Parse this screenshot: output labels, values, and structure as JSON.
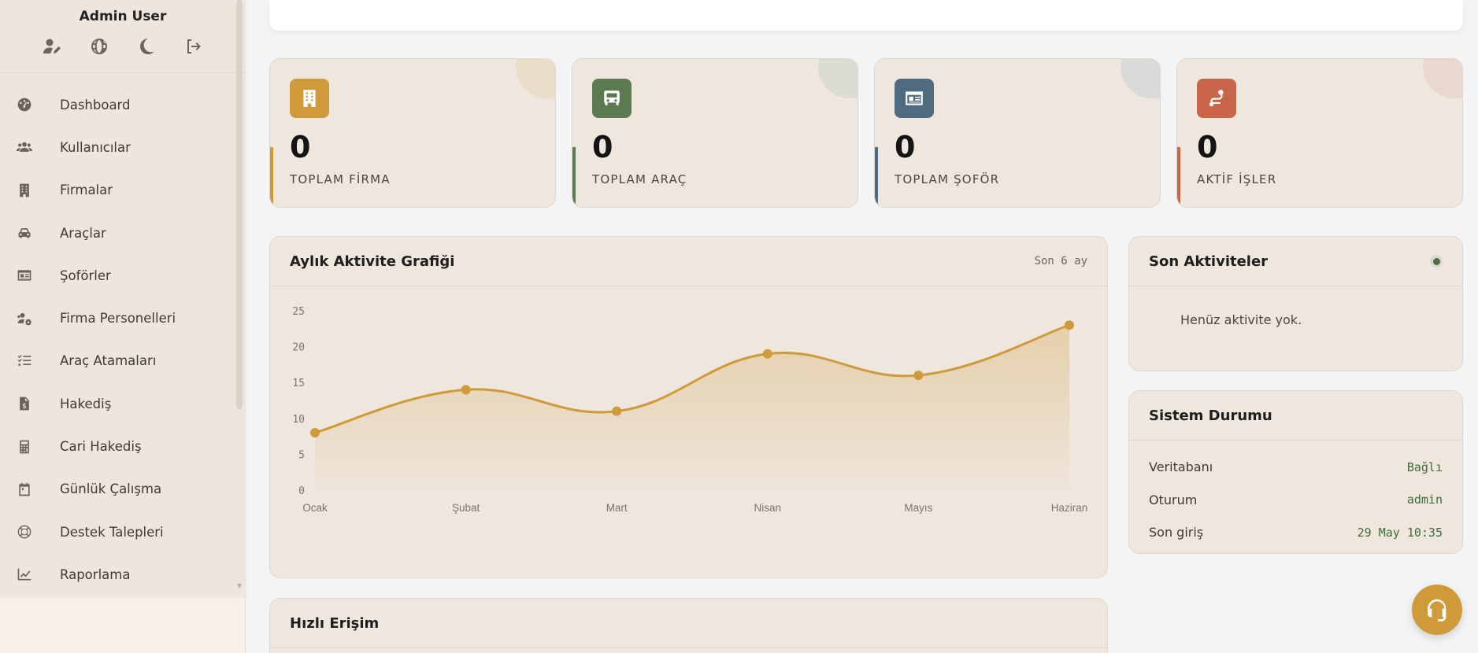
{
  "user": {
    "name": "Admin User",
    "actions": [
      {
        "icon": "user-edit-icon"
      },
      {
        "icon": "globe-icon"
      },
      {
        "icon": "moon-icon"
      },
      {
        "icon": "logout-icon"
      }
    ]
  },
  "sidebar": {
    "items": [
      {
        "label": "Dashboard",
        "icon": "dashboard-icon"
      },
      {
        "label": "Kullanıcılar",
        "icon": "users-icon"
      },
      {
        "label": "Firmalar",
        "icon": "building-icon"
      },
      {
        "label": "Araçlar",
        "icon": "car-icon"
      },
      {
        "label": "Şoförler",
        "icon": "id-card-icon"
      },
      {
        "label": "Firma Personelleri",
        "icon": "users-cog-icon"
      },
      {
        "label": "Araç Atamaları",
        "icon": "list-check-icon"
      },
      {
        "label": "Hakediş",
        "icon": "invoice-dollar-icon"
      },
      {
        "label": "Cari Hakediş",
        "icon": "calculator-icon"
      },
      {
        "label": "Günlük Çalışma",
        "icon": "calendar-icon"
      },
      {
        "label": "Destek Talepleri",
        "icon": "lifebuoy-icon"
      },
      {
        "label": "Raporlama",
        "icon": "chart-line-icon"
      }
    ]
  },
  "stats": [
    {
      "value": "0",
      "label": "TOPLAM FİRMA",
      "color": "#cf9a39",
      "deco": "#e9dcc9",
      "icon": "building-icon"
    },
    {
      "value": "0",
      "label": "TOPLAM ARAÇ",
      "color": "#5c7a4f",
      "deco": "#dcdcd2",
      "icon": "bus-icon"
    },
    {
      "value": "0",
      "label": "TOPLAM ŞOFÖR",
      "color": "#4f6b80",
      "deco": "#d9dbd9",
      "icon": "id-card-icon"
    },
    {
      "value": "0",
      "label": "AKTİF İŞLER",
      "color": "#c9664a",
      "deco": "#ead8cf",
      "icon": "route-icon"
    }
  ],
  "chart": {
    "title": "Aylık Aktivite Grafiği",
    "subtitle": "Son 6 ay"
  },
  "chart_data": {
    "type": "area",
    "categories": [
      "Ocak",
      "Şubat",
      "Mart",
      "Nisan",
      "Mayıs",
      "Haziran"
    ],
    "values": [
      8,
      14,
      11,
      19,
      16,
      23
    ],
    "yticks": [
      0,
      5,
      10,
      15,
      20,
      25
    ],
    "ylim": [
      0,
      25
    ],
    "color": "#cf9a39",
    "grid": false
  },
  "activity": {
    "title": "Son Aktiviteler",
    "empty": "Henüz aktivite yok."
  },
  "system": {
    "title": "Sistem Durumu",
    "rows": [
      {
        "key": "Veritabanı",
        "value": "Bağlı"
      },
      {
        "key": "Oturum",
        "value": "admin"
      },
      {
        "key": "Son giriş",
        "value": "29 May 10:35"
      }
    ]
  },
  "quick": {
    "title": "Hızlı Erişim"
  },
  "fab": {
    "icon": "headset-icon"
  }
}
